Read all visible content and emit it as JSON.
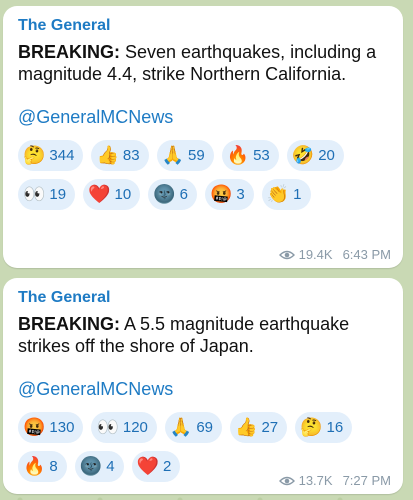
{
  "messages": [
    {
      "sender": "The General",
      "headline": "BREAKING:",
      "text": " Seven earthquakes, including a magnitude 4.4, strike Northern California.",
      "handle": "@GeneralMCNews",
      "reactions": [
        {
          "emoji": "🤔",
          "count": "344",
          "icon": "thinking-face-icon"
        },
        {
          "emoji": "👍",
          "count": "83",
          "icon": "thumbs-up-icon"
        },
        {
          "emoji": "🙏",
          "count": "59",
          "icon": "folded-hands-icon"
        },
        {
          "emoji": "🔥",
          "count": "53",
          "icon": "fire-icon"
        },
        {
          "emoji": "🤣",
          "count": "20",
          "icon": "rofl-icon"
        },
        {
          "emoji": "👀",
          "count": "19",
          "icon": "eyes-icon"
        },
        {
          "emoji": "❤️",
          "count": "10",
          "icon": "red-heart-icon"
        },
        {
          "emoji": "🌚",
          "count": "6",
          "icon": "new-moon-face-icon"
        },
        {
          "emoji": "🤬",
          "count": "3",
          "icon": "cursing-face-icon"
        },
        {
          "emoji": "👏",
          "count": "1",
          "icon": "clapping-hands-icon"
        }
      ],
      "views": "19.4K",
      "time": "6:43 PM"
    },
    {
      "sender": "The General",
      "headline": "BREAKING:",
      "text": " A 5.5 magnitude earthquake strikes off the shore of Japan.",
      "handle": "@GeneralMCNews",
      "reactions": [
        {
          "emoji": "🤬",
          "count": "130",
          "icon": "cursing-face-icon"
        },
        {
          "emoji": "👀",
          "count": "120",
          "icon": "eyes-icon"
        },
        {
          "emoji": "🙏",
          "count": "69",
          "icon": "folded-hands-icon"
        },
        {
          "emoji": "👍",
          "count": "27",
          "icon": "thumbs-up-icon"
        },
        {
          "emoji": "🤔",
          "count": "16",
          "icon": "thinking-face-icon"
        },
        {
          "emoji": "🔥",
          "count": "8",
          "icon": "fire-icon"
        },
        {
          "emoji": "🌚",
          "count": "4",
          "icon": "new-moon-face-icon"
        },
        {
          "emoji": "❤️",
          "count": "2",
          "icon": "red-heart-icon"
        }
      ],
      "views": "13.7K",
      "time": "7:27 PM"
    }
  ],
  "colors": {
    "accent": "#1e7bc4",
    "chip_bg": "#e3effb",
    "background": "#c9d9b4"
  }
}
